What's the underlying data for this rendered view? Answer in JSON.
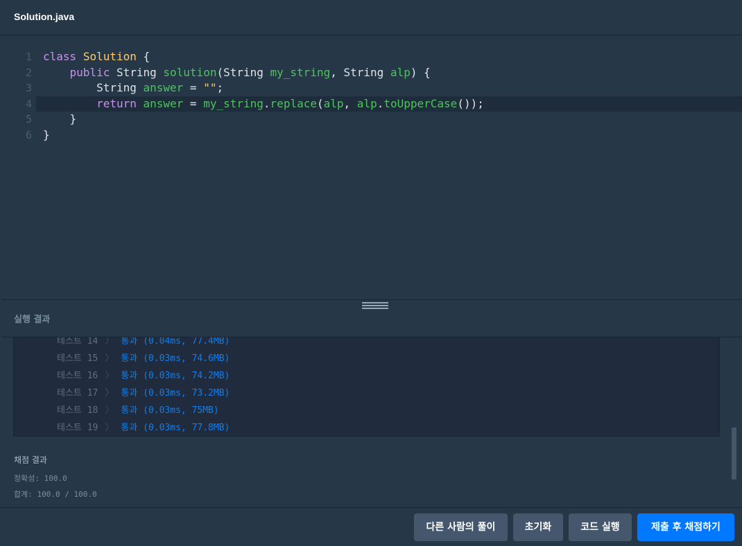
{
  "tab": {
    "filename": "Solution.java"
  },
  "editor": {
    "lines": [
      {
        "num": "1",
        "tokens": [
          {
            "t": "class",
            "c": "kw"
          },
          {
            "t": " "
          },
          {
            "t": "Solution",
            "c": "cls"
          },
          {
            "t": " {"
          }
        ]
      },
      {
        "num": "2",
        "tokens": [
          {
            "t": "    "
          },
          {
            "t": "public",
            "c": "kw"
          },
          {
            "t": " String "
          },
          {
            "t": "solution",
            "c": "fn"
          },
          {
            "t": "(String "
          },
          {
            "t": "my_string",
            "c": "var"
          },
          {
            "t": ", String "
          },
          {
            "t": "alp",
            "c": "var"
          },
          {
            "t": ") {"
          }
        ]
      },
      {
        "num": "3",
        "tokens": [
          {
            "t": "        String "
          },
          {
            "t": "answer",
            "c": "var"
          },
          {
            "t": " = "
          },
          {
            "t": "\"\"",
            "c": "str"
          },
          {
            "t": ";"
          }
        ]
      },
      {
        "num": "4",
        "active": true,
        "tokens": [
          {
            "t": "        "
          },
          {
            "t": "return",
            "c": "kw"
          },
          {
            "t": " "
          },
          {
            "t": "answer",
            "c": "var"
          },
          {
            "t": " = "
          },
          {
            "t": "my_string",
            "c": "var"
          },
          {
            "t": "."
          },
          {
            "t": "replace",
            "c": "fn"
          },
          {
            "t": "("
          },
          {
            "t": "alp",
            "c": "var"
          },
          {
            "t": ", "
          },
          {
            "t": "alp",
            "c": "var"
          },
          {
            "t": "."
          },
          {
            "t": "toUpperCase",
            "c": "fn"
          },
          {
            "t": "());"
          }
        ]
      },
      {
        "num": "5",
        "tokens": [
          {
            "t": "    }"
          }
        ]
      },
      {
        "num": "6",
        "tokens": [
          {
            "t": "}"
          }
        ]
      }
    ]
  },
  "results": {
    "title": "실행 결과",
    "tests": [
      {
        "label": "테스트 14",
        "result": "통과 (0.04ms, 77.4MB)"
      },
      {
        "label": "테스트 15",
        "result": "통과 (0.03ms, 74.6MB)"
      },
      {
        "label": "테스트 16",
        "result": "통과 (0.03ms, 74.2MB)"
      },
      {
        "label": "테스트 17",
        "result": "통과 (0.03ms, 73.2MB)"
      },
      {
        "label": "테스트 18",
        "result": "통과 (0.03ms, 75MB)"
      },
      {
        "label": "테스트 19",
        "result": "통과 (0.03ms, 77.8MB)"
      }
    ],
    "separator": "〉"
  },
  "grading": {
    "title": "채점 결과",
    "accuracy": "정확성: 100.0",
    "total": "합계: 100.0 / 100.0"
  },
  "buttons": {
    "others": "다른 사람의 풀이",
    "reset": "초기화",
    "run": "코드 실행",
    "submit": "제출 후 채점하기"
  }
}
